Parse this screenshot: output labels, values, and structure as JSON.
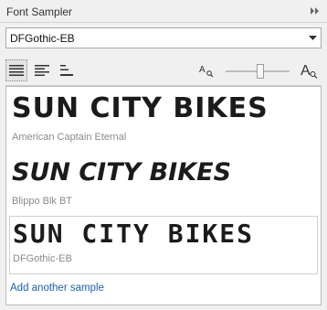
{
  "panel": {
    "title": "Font Sampler"
  },
  "font_selector": {
    "value": "DFGothic-EB"
  },
  "samples": [
    {
      "text": "SUN CITY BIKES",
      "font_name": "American Captain Eternal"
    },
    {
      "text": "SUN CITY BIKES",
      "font_name": "Blippo Blk BT"
    },
    {
      "text": "SUN CITY BIKES",
      "font_name": "DFGothic-EB"
    }
  ],
  "add_sample": "Add another sample",
  "icons": {
    "collapse": "double-chevron-right-icon",
    "single_line": "single-line-view-icon",
    "multi_line": "multi-line-view-icon",
    "waterfall": "waterfall-view-icon",
    "zoom_out": "small-text-zoom-icon",
    "zoom_in": "large-text-zoom-icon"
  },
  "colors": {
    "link": "#1a5fb4",
    "font_name": "#8a8a8a"
  }
}
